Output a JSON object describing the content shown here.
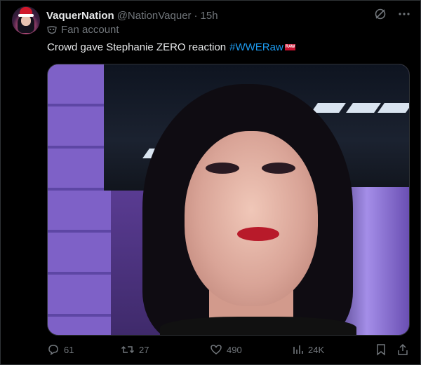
{
  "author": {
    "name": "VaquerNation",
    "handle": "@NationVaquer",
    "separator": "·",
    "time": "15h",
    "label": "Fan account"
  },
  "tweet": {
    "text": "Crowd gave Stephanie ZERO reaction",
    "hashtag": "#WWERaw",
    "hashtag_badge": "RAW"
  },
  "actions": {
    "replies": "61",
    "reposts": "27",
    "likes": "490",
    "views": "24K"
  },
  "colors": {
    "background": "#000000",
    "text": "#e7e9ea",
    "muted": "#71767b",
    "link": "#1d9bf0"
  },
  "icons": [
    "grok-icon",
    "more-icon",
    "fan-mask-icon",
    "reply-icon",
    "repost-icon",
    "like-icon",
    "views-icon",
    "bookmark-icon",
    "share-icon"
  ]
}
